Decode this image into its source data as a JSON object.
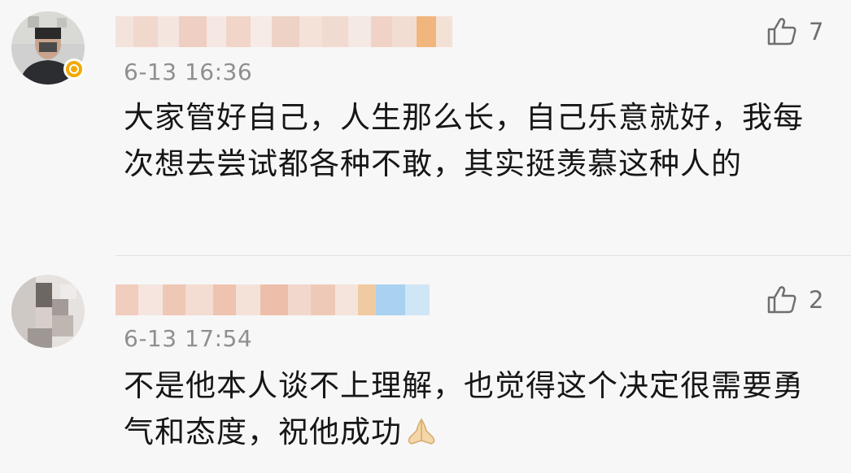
{
  "comments": [
    {
      "timestamp": "6-13 16:36",
      "body": "大家管好自己，人生那么长，自己乐意就好，我每次想去尝试都各种不敢，其实挺羡慕这种人的",
      "likes": "7",
      "verified": true,
      "verified_color": "#f2a900"
    },
    {
      "timestamp": "6-13 17:54",
      "body": "不是他本人谈不上理解，也觉得这个决定很需要勇气和态度，祝他成功",
      "likes": "2",
      "verified": false,
      "trailing_emoji": "pray-emoji"
    }
  ],
  "icons": {
    "like": "thumbs-up-outline-icon"
  }
}
